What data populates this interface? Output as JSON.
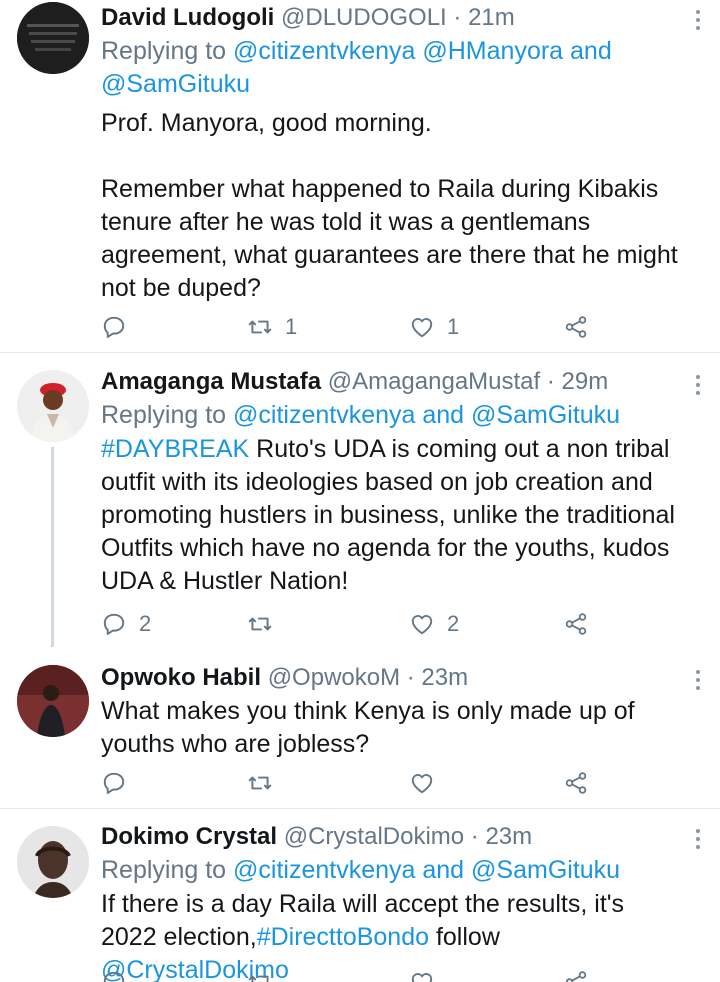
{
  "tweets": [
    {
      "name": "David Ludogoli",
      "handle": "@DLUDOGOLI",
      "time": "21m",
      "reply_prefix": "Replying to ",
      "reply_mentions_1": "@citizentvkenya @HManyora and",
      "reply_mentions_2": "@SamGituku",
      "text": "Prof. Manyora, good morning.\n\nRemember what happened to Raila during Kibakis tenure after he was told it was a gentlemans agreement, what guarantees are there that he might not be duped?",
      "reply_count": "",
      "retweet_count": "1",
      "like_count": "1"
    },
    {
      "name": "Amaganga Mustafa",
      "handle": "@AmagangaMustaf",
      "time": "29m",
      "reply_prefix": "Replying to ",
      "reply_mentions": "@citizentvkenya and @SamGituku",
      "hashtag": "#DAYBREAK",
      "text": " Ruto's UDA is coming out a non tribal outfit with its ideologies based on job creation and promoting hustlers in business, unlike the traditional Outfits which have no agenda for the youths, kudos UDA & Hustler Nation!",
      "reply_count": "2",
      "retweet_count": "",
      "like_count": "2"
    },
    {
      "name": "Opwoko Habil",
      "handle": "@OpwokoM",
      "time": "23m",
      "text": "What makes you think Kenya is only made up of youths who are jobless?",
      "reply_count": "",
      "retweet_count": "",
      "like_count": ""
    },
    {
      "name": "Dokimo Crystal",
      "handle": "@CrystalDokimo",
      "time": "23m",
      "reply_prefix": "Replying to ",
      "reply_mentions": "@citizentvkenya and @SamGituku",
      "text": "If there is a day Raila will accept the results, it's 2022 election,",
      "hashtag": "#DirecttoBondo",
      "text_after": " follow ",
      "mention": "@CrystalDokimo"
    }
  ],
  "separator": " · ",
  "icons": [
    "reply-icon",
    "retweet-icon",
    "like-icon",
    "share-icon",
    "more-options-icon"
  ],
  "colors": {
    "link": "#1b95e0",
    "muted": "#657786",
    "text": "#14171a",
    "divider": "#e1e8ed"
  }
}
